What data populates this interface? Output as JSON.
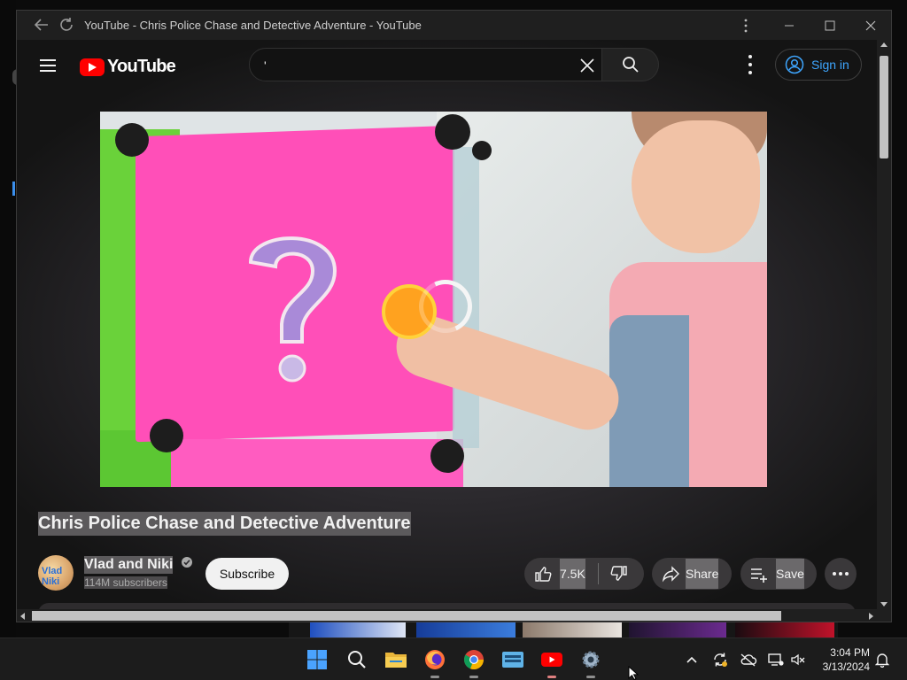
{
  "browser": {
    "window_title": "YouTube - Chris Police Chase and Detective Adventure - YouTube",
    "back_icon": "back-arrow-icon",
    "reload_icon": "reload-icon"
  },
  "masthead": {
    "logo_text": "YouTube",
    "search_value": "'",
    "search_placeholder": "",
    "sign_in_label": "Sign in"
  },
  "video": {
    "title": "Chris Police Chase and Detective Adventure",
    "loading": true
  },
  "channel": {
    "name": "Vlad and Niki",
    "subscribers": "114M subscribers",
    "avatar_text": "Vlad Niki",
    "verified": true
  },
  "actions": {
    "subscribe_label": "Subscribe",
    "like_count": "7.5K",
    "share_label": "Share",
    "save_label": "Save"
  },
  "taskbar": {
    "apps": [
      "windows-start",
      "search",
      "file-explorer",
      "firefox",
      "chrome",
      "keyboard-app",
      "youtube",
      "settings"
    ],
    "time": "3:04 PM",
    "date": "3/13/2024"
  },
  "colors": {
    "youtube_red": "#ff0000",
    "link_blue": "#3ea6ff",
    "background": "#0f0f0f"
  }
}
